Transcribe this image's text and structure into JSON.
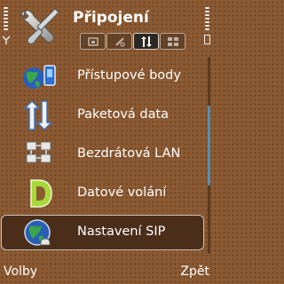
{
  "header": {
    "title": "Připojení",
    "app_icon": "tools-icon",
    "tabs": [
      {
        "icon": "tab-connections-icon",
        "active": false
      },
      {
        "icon": "tab-phone-icon",
        "active": false
      },
      {
        "icon": "tab-packet-data-icon",
        "active": true
      },
      {
        "icon": "tab-grid-icon",
        "active": false
      }
    ]
  },
  "status": {
    "signal_icon": "antenna-icon",
    "battery_icon": "battery-icon"
  },
  "list": {
    "items": [
      {
        "label": "Přístupové body",
        "icon": "access-point-icon",
        "selected": false
      },
      {
        "label": "Paketová data",
        "icon": "packet-data-icon",
        "selected": false
      },
      {
        "label": "Bezdrátová LAN",
        "icon": "wlan-icon",
        "selected": false
      },
      {
        "label": "Datové volání",
        "icon": "data-call-icon",
        "selected": false
      },
      {
        "label": "Nastavení SIP",
        "icon": "sip-settings-icon",
        "selected": true
      }
    ]
  },
  "softkeys": {
    "left": "Volby",
    "right": "Zpět"
  },
  "colors": {
    "background": "#8b5a33",
    "highlight": "#4a2e1a",
    "scroll_thumb": "#5a8fb0",
    "text": "#ffffff"
  }
}
